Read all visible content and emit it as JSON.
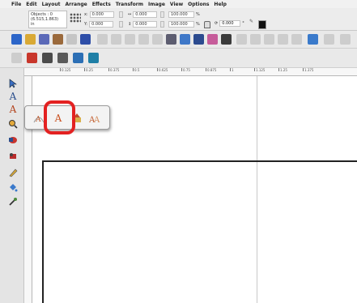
{
  "menu": [
    "File",
    "Edit",
    "Layout",
    "Arrange",
    "Effects",
    "Transform",
    "Image",
    "View",
    "Options",
    "Help"
  ],
  "properties": {
    "objects_line1": "Objects : 0",
    "objects_line2": "(6.515,1.863)",
    "objects_line3": "in",
    "x_label": "x:",
    "x_value": "0.000",
    "y_label": "Y:",
    "y_value": "0.000",
    "w_value": "0.000",
    "h_value": "0.000",
    "scale_x": "100.000",
    "scale_y": "100.000",
    "pct1": "%",
    "pct2": "%",
    "rotation": "0.000",
    "degree": "°",
    "color": "#111111"
  },
  "ruler_labels": [
    "0.125",
    "0.25",
    "0.375",
    "0.5",
    "0.625",
    "0.75",
    "0.875",
    "1",
    "1.125",
    "1.25",
    "1.375"
  ],
  "text_tools": [
    "fit-text-to-path-icon",
    "text-tool-icon",
    "vertical-text-icon",
    "text-on-path-icon"
  ],
  "accent": "#e32121"
}
